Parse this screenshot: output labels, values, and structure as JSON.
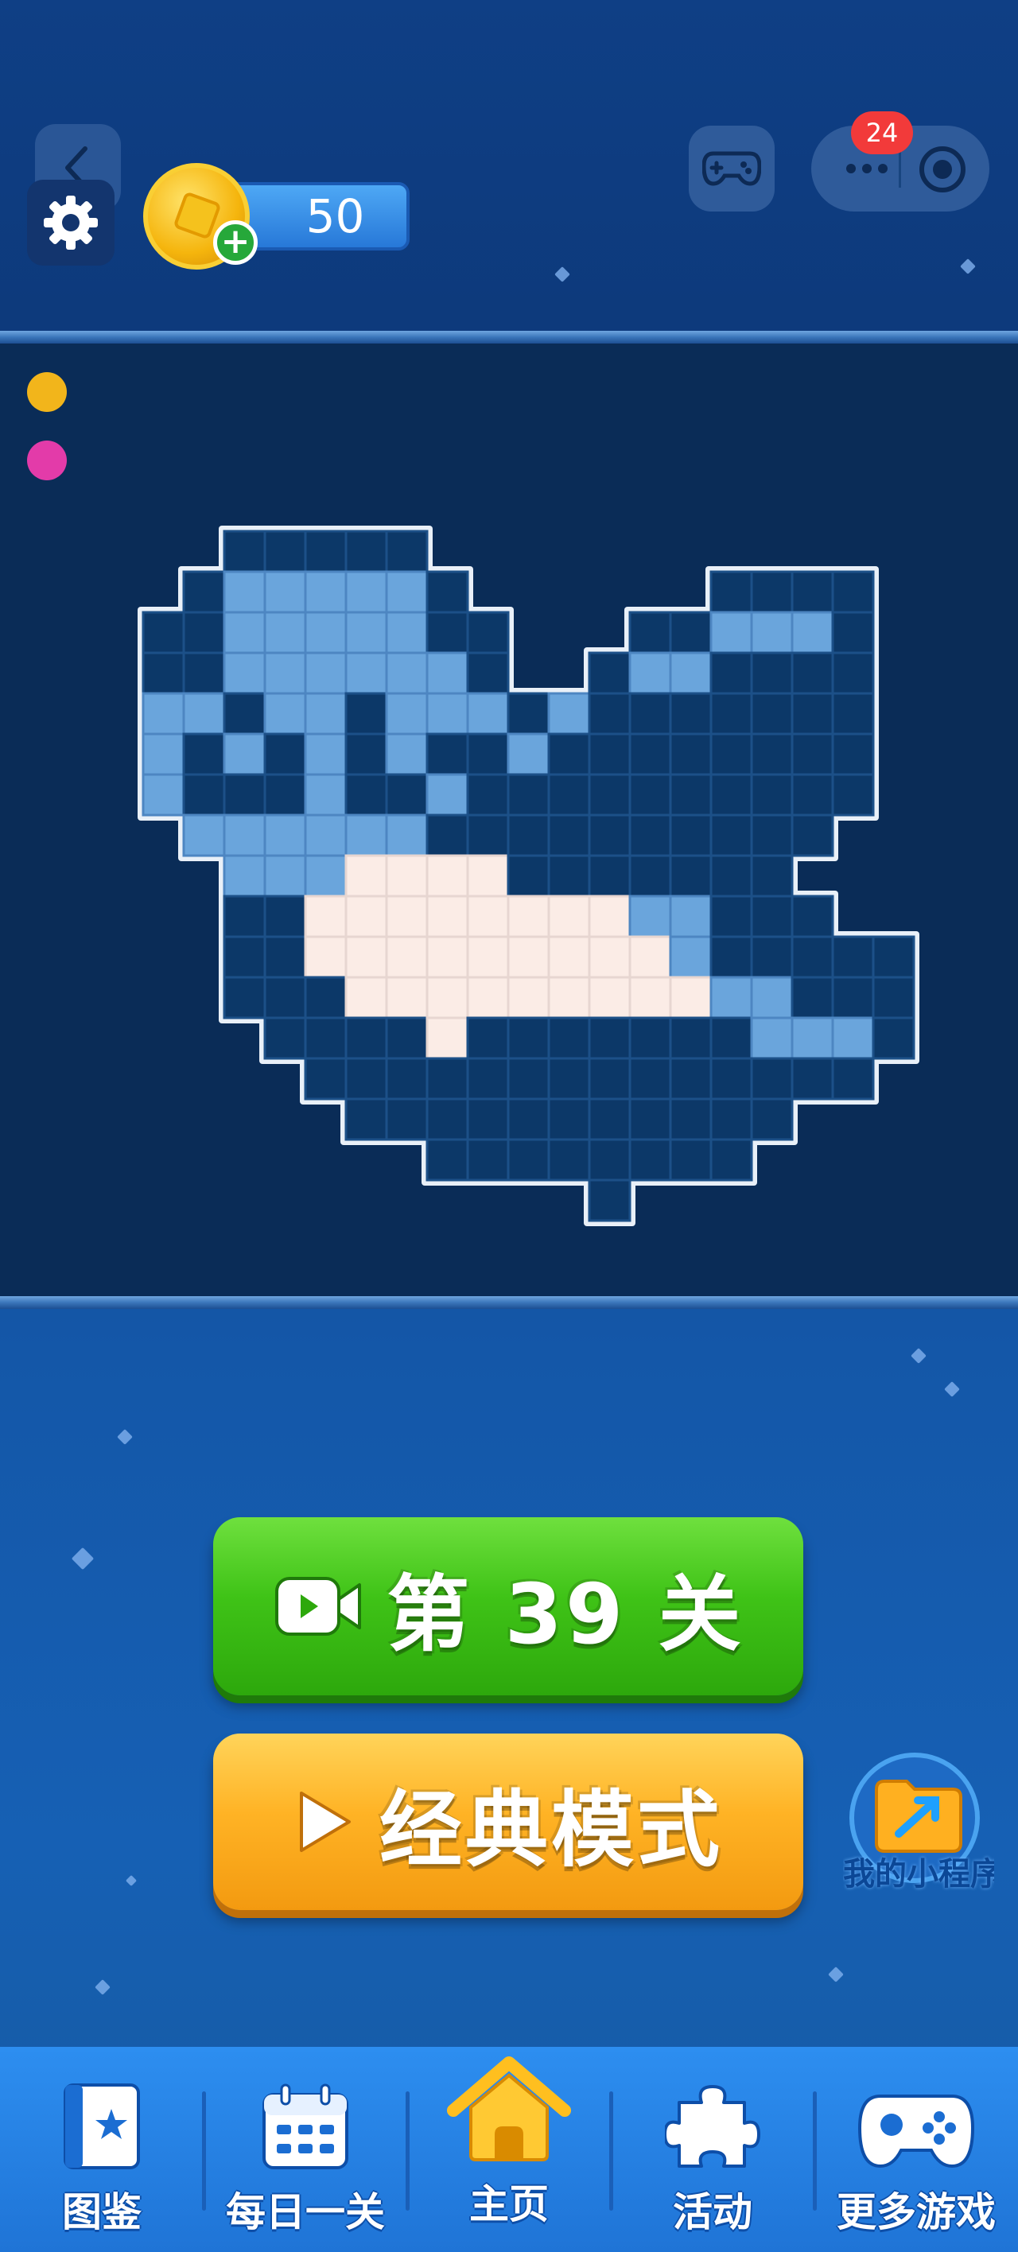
{
  "top_bar": {
    "coin_count": "50",
    "notification_count": "24"
  },
  "board": {
    "rows": [
      "..................",
      "..DDDDD...........",
      ".DLLLLLD......DDDD",
      "DDLLLLLDD...DDLLLD",
      "DDLLLLLLD..DLLDDDD",
      "LLDLLDLLLDLDDDDDDD",
      "LDLDLDLDDLDDDDDDDD",
      "LDDDLDDLDDDDDDDDDD",
      ".LLLLLLDDDDDDDDDD.",
      "..LLLWWWWDDDDDDD..",
      "..DDWWWWWWWWLLDDD.",
      "..DDWWWWWWWWWLDDDDD",
      "..DDDWWWWWWWWWLLDDD",
      "...DDDDWDDDDDDDLLLD",
      "....DDDDDDDDDDDDDD.",
      ".....DDDDDDDDDDD...",
      ".......DDDDDDDD....",
      "...........D......."
    ],
    "colors": {
      "D": "#0c3868",
      "L": "#6aa5dc",
      "W": "#fbece6"
    }
  },
  "indicators": [
    {
      "color": "#f2b51b"
    },
    {
      "color": "#e33ba9"
    }
  ],
  "buttons": {
    "level": "第 39 关",
    "classic": "经典模式",
    "folder_label": "我的小程序"
  },
  "nav": [
    {
      "label": "图鉴",
      "icon": "book-star-icon"
    },
    {
      "label": "每日一关",
      "icon": "calendar-icon"
    },
    {
      "label": "主页",
      "icon": "home-icon"
    },
    {
      "label": "活动",
      "icon": "puzzle-icon"
    },
    {
      "label": "更多游戏",
      "icon": "gamepad-icon"
    }
  ]
}
